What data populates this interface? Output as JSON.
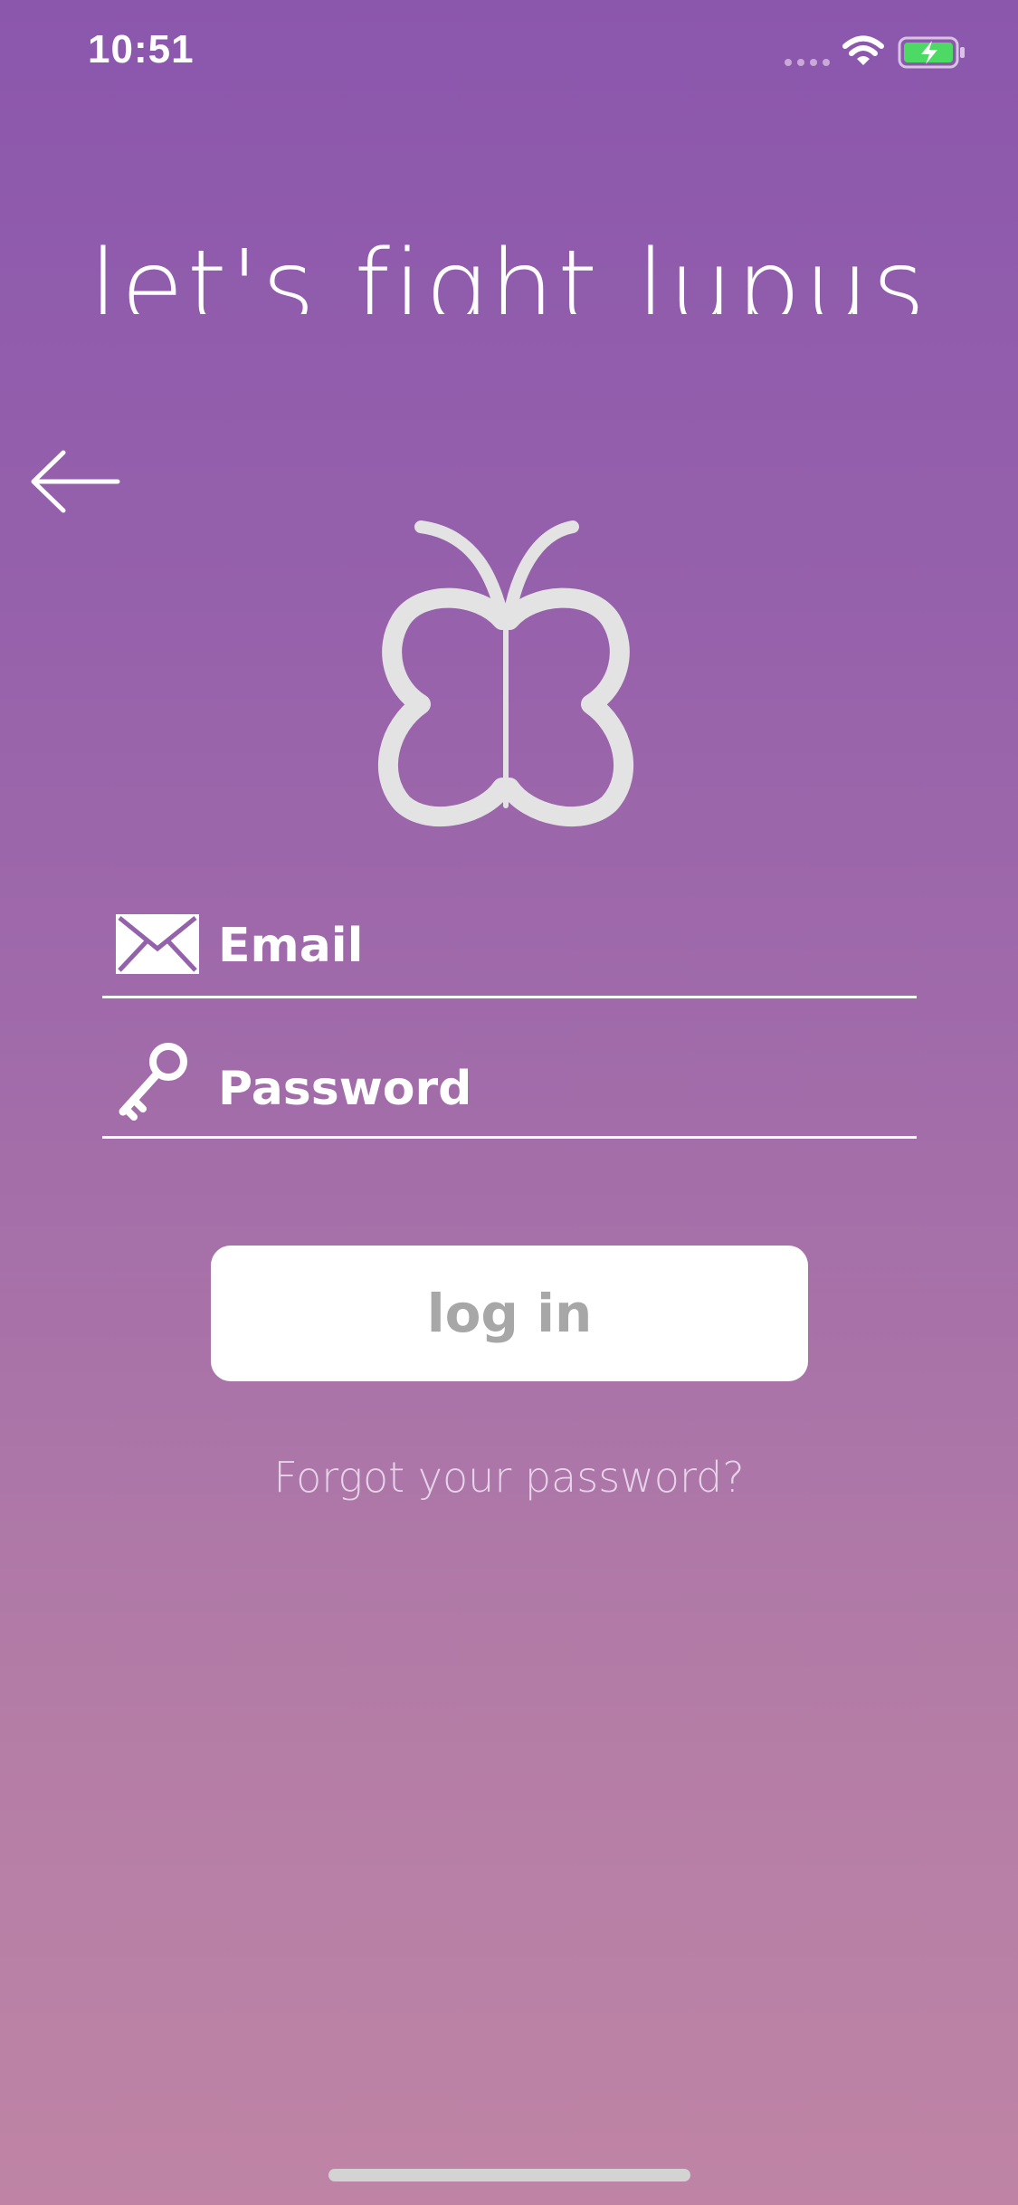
{
  "status_bar": {
    "time": "10:51",
    "icons": [
      "signal-dots-icon",
      "wifi-icon",
      "battery-charging-icon"
    ],
    "battery_color": "#4cd964"
  },
  "header": {
    "headline": "let's fight lupus",
    "back_icon": "arrow-left-icon"
  },
  "logo": {
    "icon": "butterfly-icon",
    "color": "#e3e3e3"
  },
  "form": {
    "email": {
      "icon": "envelope-icon",
      "placeholder": "Email",
      "value": ""
    },
    "password": {
      "icon": "key-icon",
      "placeholder": "Password",
      "value": ""
    },
    "login_label": "log in",
    "forgot_label": "Forgot your password?"
  },
  "colors": {
    "gradient_top": "#8b57ad",
    "gradient_bottom": "#bf84a5",
    "button_bg": "#ffffff",
    "button_text": "#a7a7a7"
  }
}
